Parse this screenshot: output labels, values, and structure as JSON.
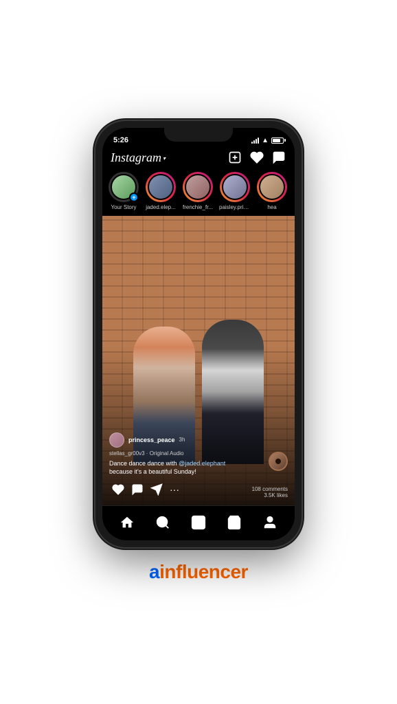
{
  "statusBar": {
    "time": "5:26",
    "batteryLevel": "80"
  },
  "header": {
    "logo": "Instagram",
    "chevron": "▾",
    "addIcon": "+",
    "heartIcon": "♡",
    "messengerIcon": "💬"
  },
  "stories": [
    {
      "id": "your-story",
      "label": "Your Story",
      "hasRing": false,
      "hasPlusBadge": true,
      "avatarClass": "av-1"
    },
    {
      "id": "jaded-elep",
      "label": "jaded.elep...",
      "hasRing": true,
      "hasPlusBadge": false,
      "avatarClass": "av-2"
    },
    {
      "id": "frenchie-fr",
      "label": "frenchie_fr...",
      "hasRing": true,
      "hasPlusBadge": false,
      "avatarClass": "av-3"
    },
    {
      "id": "paisley-prin",
      "label": "paisley.prin...",
      "hasRing": true,
      "hasPlusBadge": false,
      "avatarClass": "av-4"
    },
    {
      "id": "hea",
      "label": "hea",
      "hasRing": true,
      "hasPlusBadge": false,
      "avatarClass": "av-5"
    }
  ],
  "post": {
    "username": "princess_peace",
    "time": "3h",
    "audio": "stellas_gr00v3 · Original Audio",
    "caption": "Dance dance dance with @jaded.elephant\nbecause it's a beautiful Sunday!",
    "mention": "@jaded.elephant",
    "commentsCount": "108 comments",
    "likesCount": "3.5K likes"
  },
  "bottomNav": {
    "items": [
      "home",
      "search",
      "reels",
      "shop",
      "profile"
    ]
  },
  "brand": {
    "prefix": "a",
    "suffix": "influencer"
  }
}
